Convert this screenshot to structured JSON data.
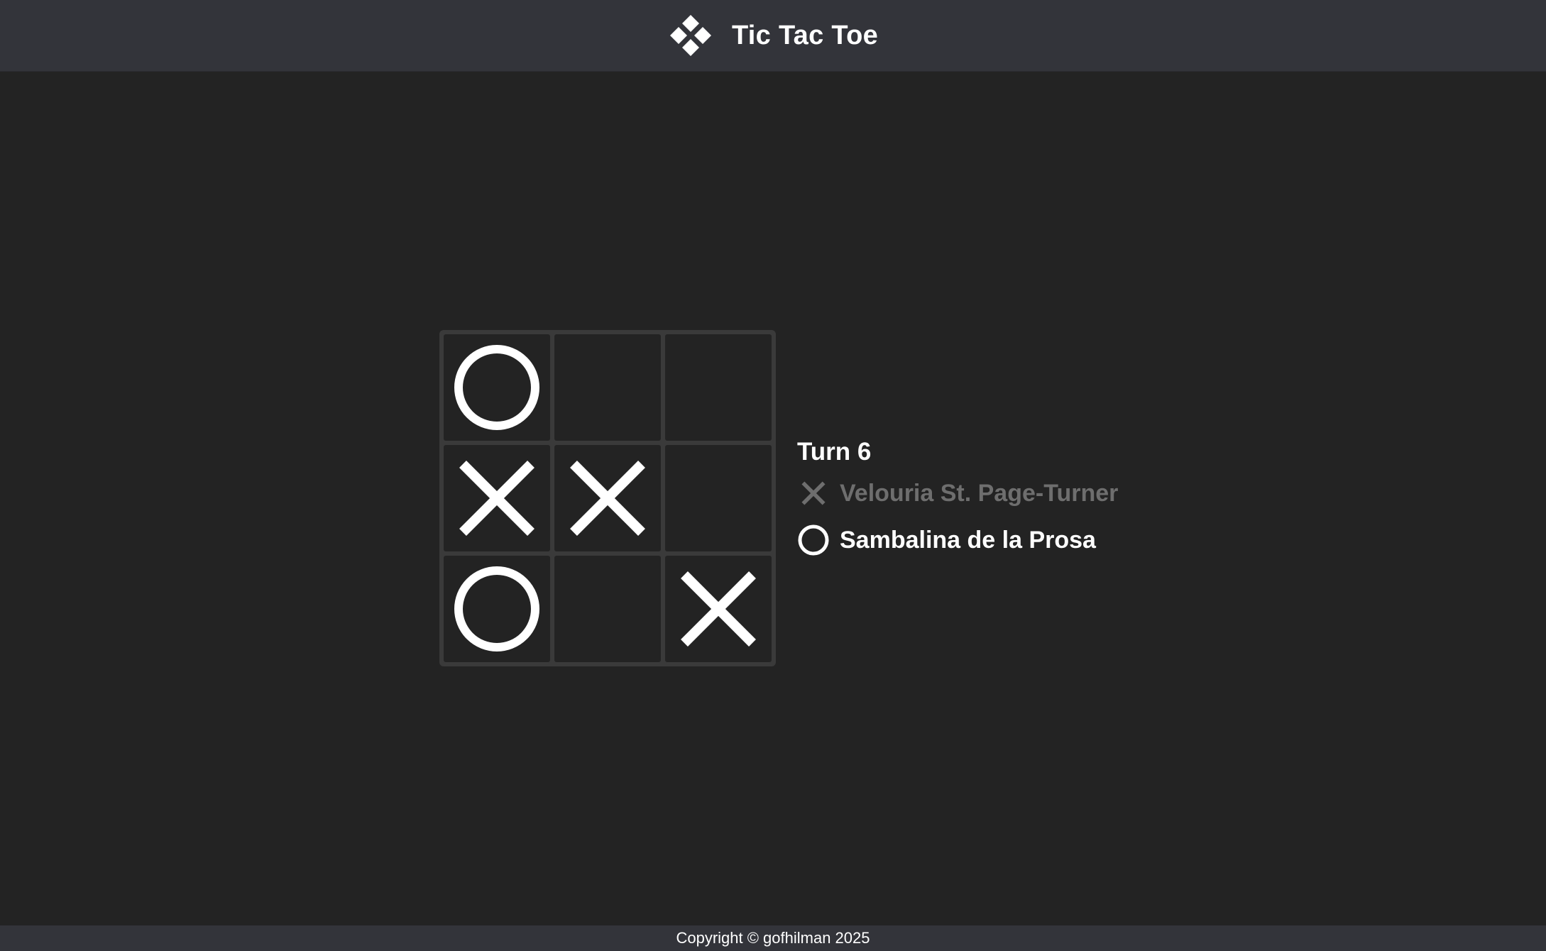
{
  "header": {
    "title": "Tic Tac Toe",
    "logo_icon": "four-diamonds-logo-icon"
  },
  "game": {
    "turn_label": "Turn 6",
    "board": [
      "O",
      "",
      "",
      "X",
      "X",
      "",
      "O",
      "",
      "X"
    ],
    "players": [
      {
        "mark": "X",
        "name": "Velouria St. Page-Turner",
        "active": false
      },
      {
        "mark": "O",
        "name": "Sambalina de la Prosa",
        "active": true
      }
    ]
  },
  "footer": {
    "copyright": "Copyright © gofhilman 2025"
  },
  "colors": {
    "background": "#232323",
    "header": "#33343a",
    "board_border": "#3a3a3a",
    "mark": "#ffffff",
    "inactive_text": "#6e6e6e"
  }
}
